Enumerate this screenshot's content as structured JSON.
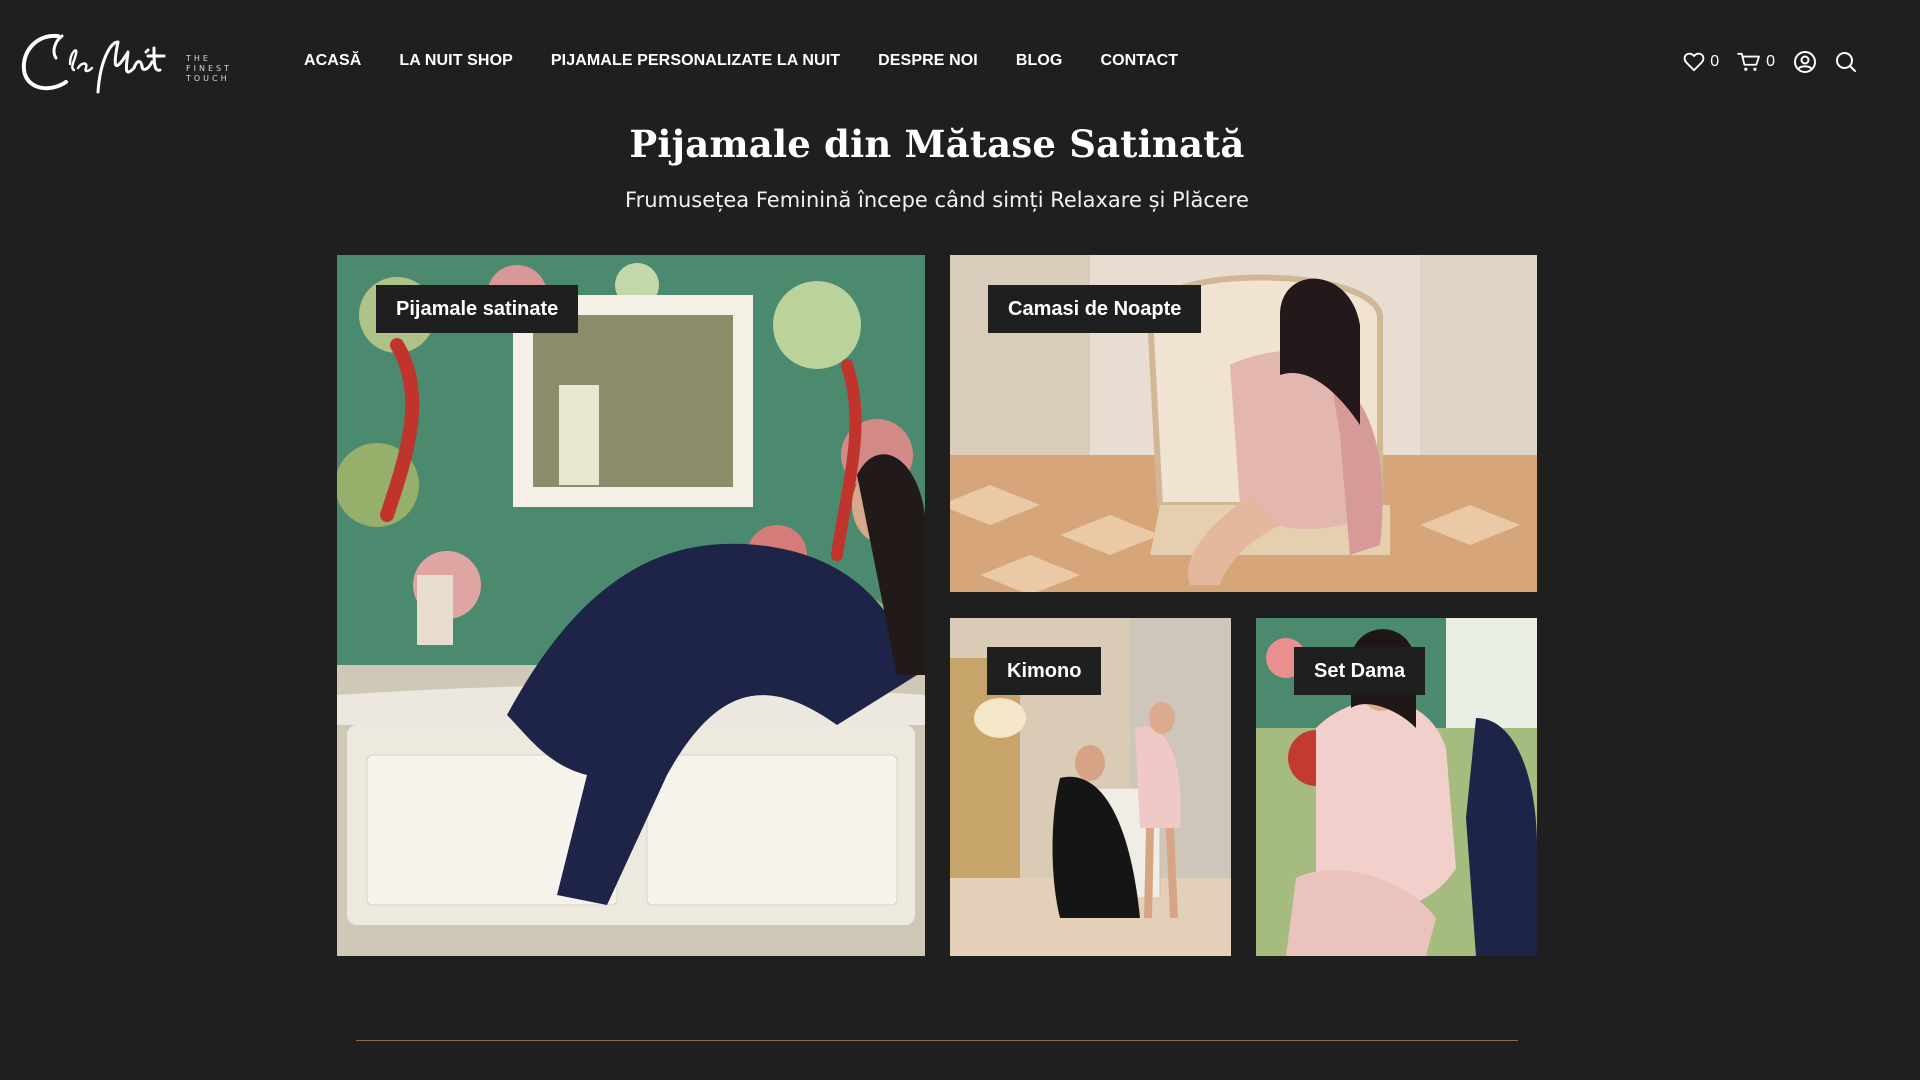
{
  "brand": {
    "logo_text": "la Nuit",
    "tagline_lines": [
      "THE",
      "FINEST",
      "TOUCH"
    ]
  },
  "nav": {
    "items": [
      {
        "label": "ACASĂ"
      },
      {
        "label": "LA NUIT SHOP"
      },
      {
        "label": "PIJAMALE PERSONALIZATE LA NUIT"
      },
      {
        "label": "DESPRE NOI"
      },
      {
        "label": "BLOG"
      },
      {
        "label": "CONTACT"
      }
    ]
  },
  "header_icons": {
    "wishlist": {
      "icon": "heart-icon",
      "count": "0"
    },
    "cart": {
      "icon": "cart-icon",
      "count": "0"
    },
    "account": {
      "icon": "user-icon"
    },
    "search": {
      "icon": "search-icon"
    }
  },
  "hero": {
    "title": "Pijamale din Mătase Satinată",
    "subtitle": "Frumusețea Feminină începe când simți Relaxare și Plăcere"
  },
  "categories": [
    {
      "label": "Pijamale satinate"
    },
    {
      "label": "Camasi de Noapte"
    },
    {
      "label": "Kimono"
    },
    {
      "label": "Set Dama"
    }
  ],
  "colors": {
    "background": "#1f1f1f",
    "divider": "#8a6e5a",
    "text": "#ffffff"
  }
}
